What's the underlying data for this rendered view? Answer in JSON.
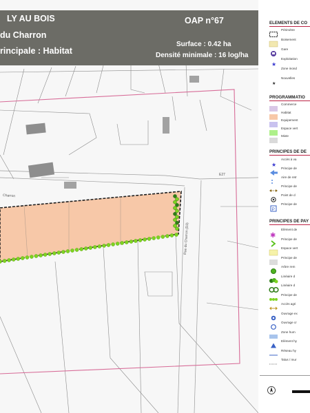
{
  "banner": {
    "title_line1": "LY AU BOIS",
    "title_line2": "du Charron",
    "title_line3": "rincipale : Habitat",
    "oap_number": "OAP n°67",
    "surface": "Surface : 0.42 ha",
    "density": "Densité minimale : 16 log/ha"
  },
  "map": {
    "road_label_e27": "E27",
    "street_label_left": "Charron",
    "street_label_vertical": "Rue du Charron (D3)"
  },
  "legend": {
    "section_perimeter": "ELEMENTS DE CO",
    "perimeter_items": [
      {
        "label": "Périmètre",
        "symbol": "dashed-rectangle-icon"
      },
      {
        "label": "Boisement",
        "symbol": "hatched-square-icon"
      },
      {
        "label": "Gare",
        "symbol": "train-station-icon"
      },
      {
        "label": "Exploitation",
        "symbol": "star-icon"
      },
      {
        "label": "Zone inond",
        "symbol": "blank-icon"
      },
      {
        "label": "Nouvelles",
        "symbol": "small-star-icon"
      }
    ],
    "section_programming": "PROGRAMMATIO",
    "programming_items": [
      {
        "label": "Commerce",
        "color": "#d9c7e6"
      },
      {
        "label": "Habitat",
        "color": "#f7c8a8"
      },
      {
        "label": "Equipement",
        "color": "#c9c2ef"
      },
      {
        "label": "Espace vert",
        "color": "#aef08a"
      },
      {
        "label": "Mixte",
        "color": "#dadada"
      }
    ],
    "section_access": "PRINCIPES DE DE",
    "access_items": [
      {
        "label": "Accès à va",
        "symbol": "star-icon"
      },
      {
        "label": "Principe de",
        "symbol": "arrow-icon"
      },
      {
        "label": "Aire de retr",
        "symbol": "dots-icon"
      },
      {
        "label": "Principe de",
        "symbol": "dashed-arrow-icon"
      },
      {
        "label": "Point de d",
        "symbol": "target-icon"
      },
      {
        "label": "Principe de",
        "symbol": "parking-icon"
      }
    ],
    "section_landscape": "PRINCIPES DE PAY",
    "landscape_items": [
      {
        "label": "Elément de",
        "symbol": "asterisk-icon"
      },
      {
        "label": "Principe de",
        "symbol": "chevron-icon"
      },
      {
        "label": "Espace vert",
        "symbol": "yellow-square-icon"
      },
      {
        "label": "Principe de",
        "symbol": "grey-square-icon"
      },
      {
        "label": "Arbre rem",
        "symbol": "tree-circle-icon"
      },
      {
        "label": "Linéaire d",
        "symbol": "tree-cluster-icon"
      },
      {
        "label": "Linéaire d",
        "symbol": "double-tree-icon"
      },
      {
        "label": "Principe de",
        "symbol": "hedge-dots-icon"
      },
      {
        "label": "Accès agri",
        "symbol": "double-arrow-icon"
      },
      {
        "label": "Ouvrage ex",
        "symbol": "circle-blue-icon"
      },
      {
        "label": "Ouvrage cr",
        "symbol": "circle-blue-outline-icon"
      },
      {
        "label": "Zone hum",
        "symbol": "blue-band-icon"
      },
      {
        "label": "Elément hy",
        "symbol": "triangle-icon"
      },
      {
        "label": "Réseau hy",
        "symbol": "blue-line-icon"
      },
      {
        "label": "Talus / mur",
        "symbol": "dotted-line-icon"
      }
    ],
    "colors": {
      "habitat_fill": "#f7c8a8",
      "banner_bg": "#6c6c66",
      "perimeter_pink": "#d76b97",
      "hedge_green": "#7ed321",
      "dark_green": "#2e7d17"
    }
  }
}
